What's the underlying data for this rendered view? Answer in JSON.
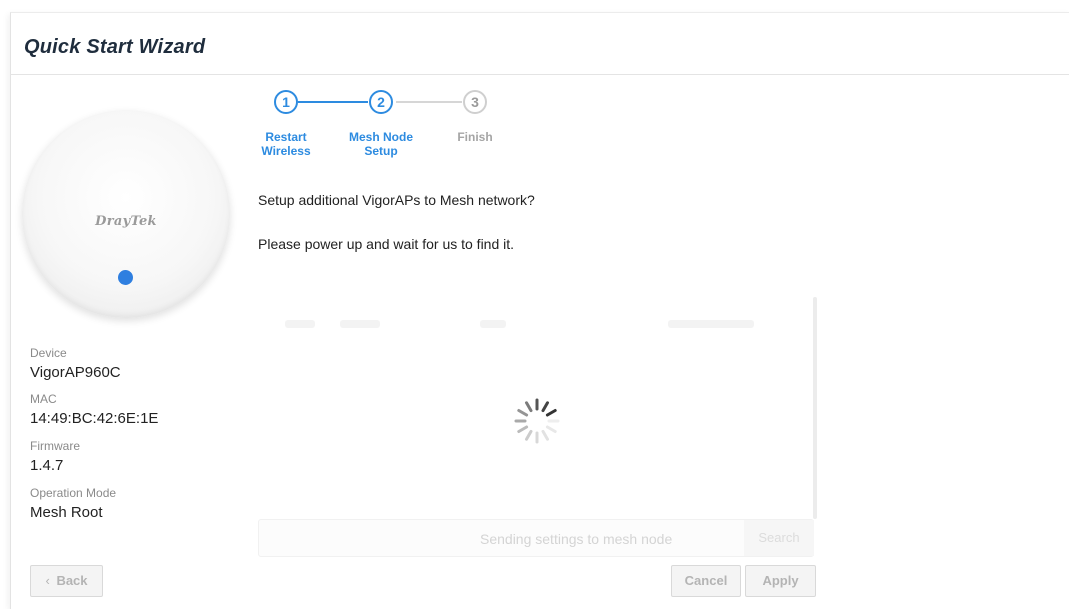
{
  "wizard": {
    "title": "Quick Start Wizard"
  },
  "device": {
    "logo": "DrayTek",
    "fields": [
      {
        "label": "Device",
        "value": "VigorAP960C"
      },
      {
        "label": "MAC",
        "value": "14:49:BC:42:6E:1E"
      },
      {
        "label": "Firmware",
        "value": "1.4.7"
      },
      {
        "label": "Operation Mode",
        "value": "Mesh Root"
      }
    ]
  },
  "stepper": {
    "steps": [
      {
        "number": "1",
        "label": "Restart Wireless",
        "state": "active"
      },
      {
        "number": "2",
        "label": "Mesh Node Setup",
        "state": "active"
      },
      {
        "number": "3",
        "label": "Finish",
        "state": "inactive"
      }
    ],
    "active_color": "#2d8be0",
    "inactive_color": "#cfcfcf"
  },
  "content": {
    "question": "Setup additional VigorAPs to Mesh network?",
    "instruction": "Please power up and wait for us to find it.",
    "status": "Sending settings to mesh node",
    "search_button": "Search"
  },
  "footer": {
    "back": "Back",
    "cancel": "Cancel",
    "apply": "Apply"
  },
  "icons": {
    "back": "chevron-left-icon",
    "spinner": "loading-spinner-icon"
  }
}
